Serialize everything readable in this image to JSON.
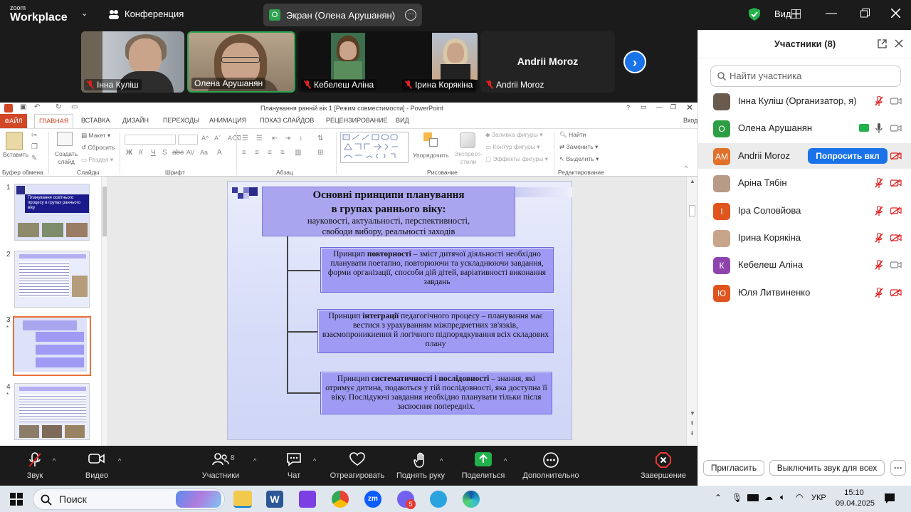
{
  "zoom": {
    "brand_top": "zoom",
    "brand_bottom": "Workplace",
    "conference_label": "Конференция",
    "share_indicator": "Экран (Олена Арушанян)",
    "share_badge": "О",
    "view_label": "Вид"
  },
  "video_tiles": [
    {
      "name": "Інна Куліш"
    },
    {
      "name": "Олена Арушанян"
    },
    {
      "name": "Кебелеш Аліна"
    },
    {
      "name": "Ірина Корякіна"
    },
    {
      "name": "Andrii Moroz",
      "big_label": "Andrii Moroz"
    }
  ],
  "ppt": {
    "window_title": "Планування ранній вік 1 [Режим совместимости] - PowerPoint",
    "help": "?",
    "login": "Вход",
    "tabs": [
      "ФАЙЛ",
      "ГЛАВНАЯ",
      "ВСТАВКА",
      "ДИЗАЙН",
      "ПЕРЕХОДЫ",
      "АНИМАЦИЯ",
      "ПОКАЗ СЛАЙДОВ",
      "РЕЦЕНЗИРОВАНИЕ",
      "ВИД"
    ],
    "ribbon": {
      "paste": "Вставить",
      "new_slide": "Создать слайд",
      "layout": "Макет",
      "reset": "Сбросить",
      "section": "Раздел",
      "arrange": "Упорядочить",
      "quick_styles": "Экспресс-стили",
      "fill": "Заливка фигуры",
      "outline": "Контур фигуры",
      "effects": "Эффекты фигуры",
      "find": "Найти",
      "replace": "Заменить",
      "select": "Выделить",
      "groups": [
        "Буфер обмена",
        "Слайды",
        "Шрифт",
        "Абзац",
        "Рисование",
        "Редактирование"
      ]
    },
    "thumbs": [
      {
        "num": "1",
        "title": "Планування освітнього процесу в групах раннього віку"
      },
      {
        "num": "2"
      },
      {
        "num": "3"
      },
      {
        "num": "4"
      }
    ],
    "slide": {
      "title_line1": "Основні принципи планування",
      "title_line2": "в групах раннього віку:",
      "title_line3": "науковості, актуальності, перспективності,",
      "title_line4": "свободи вибору, реальності заходів",
      "box1_pre": "Принцип ",
      "box1_bold": "повторності",
      "box1_rest": " – зміст дитячої діяльності необхідно планувати поетапно, повторюючи та ускладнюючи завдання, форми організації, способи дій дітей, варіативності виконання завдань",
      "box2_pre": "Принцип ",
      "box2_bold": "інтеграції",
      "box2_rest": " педагогічного процесу – планування має вестися з урахуванням міжпредметних зв'язків, взаємопроникнення й логічного підпорядкування всіх складових плану",
      "box3_pre": "Принцип ",
      "box3_bold": "систематичності і послідовності",
      "box3_rest": " – знання, які отримує дитина, подаються у тій послідовності, яка доступна її віку. Послідуючі завдання необхідно планувати тільки після засвоєння попередніх."
    }
  },
  "participants": {
    "title": "Участники (8)",
    "search_placeholder": "Найти участника",
    "list": [
      {
        "name": "Інна Куліш (Организатор, я)",
        "initials": "",
        "color": "#6b5a4e"
      },
      {
        "name": "Олена Арушанян",
        "initials": "О",
        "color": "#2e9e45"
      },
      {
        "name": "Andrii Moroz",
        "initials": "AM",
        "color": "#e0702a"
      },
      {
        "name": "Аріна Тябін",
        "initials": "",
        "color": "#b99a86"
      },
      {
        "name": "Іра Соловйова",
        "initials": "І",
        "color": "#e0541e"
      },
      {
        "name": "Ірина Корякіна",
        "initials": "",
        "color": "#c8a58a"
      },
      {
        "name": "Кебелеш Аліна",
        "initials": "К",
        "color": "#8e44ad"
      },
      {
        "name": "Юля Литвиненко",
        "initials": "Ю",
        "color": "#e0541e"
      }
    ],
    "ask_unmute": "Попросить вкл",
    "invite": "Пригласить",
    "mute_all": "Выключить звук для всех",
    "more": "···"
  },
  "toolbar": {
    "audio": "Звук",
    "video": "Видео",
    "participants": "Участники",
    "participants_count": "8",
    "chat": "Чат",
    "react": "Отреагировать",
    "raise_hand": "Поднять руку",
    "share": "Поделиться",
    "more": "Дополнительно",
    "end": "Завершение"
  },
  "taskbar": {
    "search": "Поиск",
    "lang": "УКР",
    "time": "15:10",
    "date": "09.04.2025",
    "viber_badge": "5"
  },
  "colors": {
    "zoom_dark": "#1b1b1b",
    "accent_blue": "#1a73e8",
    "ppt_orange": "#d24726",
    "slide_box": "#9f9bf4"
  }
}
